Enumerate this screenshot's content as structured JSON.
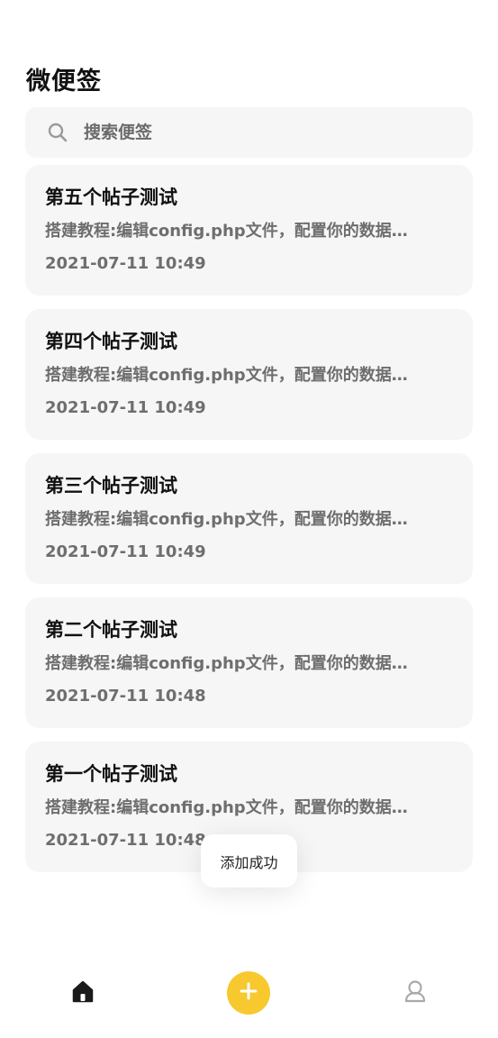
{
  "app": {
    "title": "微便签"
  },
  "search": {
    "placeholder": "搜索便签",
    "value": ""
  },
  "notes": [
    {
      "title": "第五个帖子测试",
      "excerpt": "搭建教程:编辑config.php文件，配置你的数据…",
      "time": "2021-07-11 10:49"
    },
    {
      "title": "第四个帖子测试",
      "excerpt": "搭建教程:编辑config.php文件，配置你的数据…",
      "time": "2021-07-11 10:49"
    },
    {
      "title": "第三个帖子测试",
      "excerpt": "搭建教程:编辑config.php文件，配置你的数据…",
      "time": "2021-07-11 10:49"
    },
    {
      "title": "第二个帖子测试",
      "excerpt": "搭建教程:编辑config.php文件，配置你的数据…",
      "time": "2021-07-11 10:48"
    },
    {
      "title": "第一个帖子测试",
      "excerpt": "搭建教程:编辑config.php文件，配置你的数据…",
      "time": "2021-07-11 10:48"
    }
  ],
  "toast": {
    "message": "添加成功"
  },
  "tabbar": {
    "home_icon": "home-icon",
    "add_icon": "plus-icon",
    "profile_icon": "user-icon",
    "accent_color": "#f8c82f"
  },
  "colors": {
    "card_background": "#f6f6f6",
    "secondary_text": "#6e6e6e"
  }
}
